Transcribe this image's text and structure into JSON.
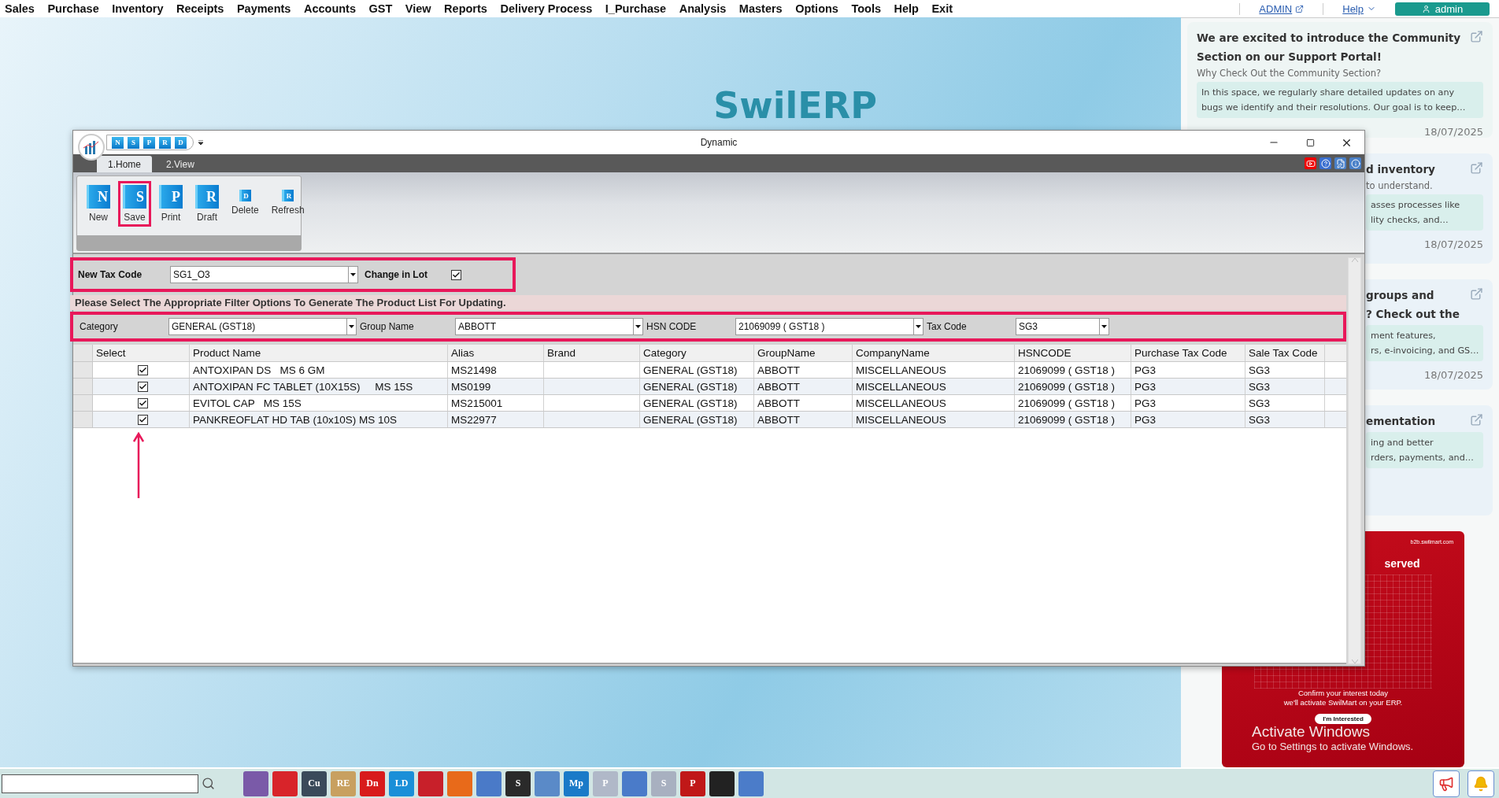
{
  "menu": {
    "items": [
      "Sales",
      "Purchase",
      "Inventory",
      "Receipts",
      "Payments",
      "Accounts",
      "GST",
      "View",
      "Reports",
      "Delivery Process",
      "I_Purchase",
      "Analysis",
      "Masters",
      "Options",
      "Tools",
      "Help",
      "Exit"
    ],
    "admin_link": "ADMIN",
    "help": "Help",
    "user": "admin"
  },
  "desktop": {
    "logo": "SwilERP"
  },
  "dialog": {
    "title": "Dynamic",
    "quick_access": [
      "N",
      "S",
      "P",
      "R",
      "D"
    ],
    "tabs": [
      {
        "label": "1.Home",
        "selected": true
      },
      {
        "label": "2.View",
        "selected": false
      }
    ],
    "ribbon_buttons": [
      {
        "label": "New",
        "glyph": "N",
        "kind": "large",
        "highlighted": false
      },
      {
        "label": "Save",
        "glyph": "S",
        "kind": "large",
        "highlighted": true
      },
      {
        "label": "Print",
        "glyph": "P",
        "kind": "large",
        "highlighted": false
      },
      {
        "label": "Draft",
        "glyph": "R",
        "kind": "large",
        "highlighted": false
      },
      {
        "label": "Delete",
        "glyph": "D",
        "kind": "small",
        "highlighted": false
      },
      {
        "label": "Refresh",
        "glyph": "R",
        "kind": "small",
        "highlighted": false
      }
    ],
    "tax_row": {
      "highlighted": true,
      "label": "New Tax Code",
      "value": "SG1_O3",
      "lot_label": "Change in Lot",
      "lot_checked": true
    },
    "notice": "Please Select The Appropriate Filter Options To Generate The Product List For Updating.",
    "filters": {
      "highlighted": true,
      "items": [
        {
          "label": "Category",
          "value": "GENERAL (GST18)"
        },
        {
          "label": "Group Name",
          "value": "ABBOTT"
        },
        {
          "label": "HSN CODE",
          "value": "21069099 ( GST18 )"
        },
        {
          "label": "Tax Code",
          "value": "SG3"
        }
      ]
    },
    "grid": {
      "select_label": "Select",
      "columns": [
        "Product Name",
        "Alias",
        "Brand",
        "Category",
        "GroupName",
        "CompanyName",
        "HSNCODE",
        "Purchase Tax Code",
        "Sale Tax Code"
      ],
      "rows": [
        {
          "checked": true,
          "cells": [
            "ANTOXIPAN DS   MS 6 GM",
            "MS21498",
            "",
            "GENERAL (GST18)",
            "ABBOTT",
            "MISCELLANEOUS",
            "21069099 ( GST18 )",
            "PG3",
            "SG3"
          ]
        },
        {
          "checked": true,
          "cells": [
            "ANTOXIPAN FC TABLET (10X15S)     MS 15S",
            "MS0199",
            "",
            "GENERAL (GST18)",
            "ABBOTT",
            "MISCELLANEOUS",
            "21069099 ( GST18 )",
            "PG3",
            "SG3"
          ]
        },
        {
          "checked": true,
          "cells": [
            "EVITOL CAP   MS 15S",
            "MS215001",
            "",
            "GENERAL (GST18)",
            "ABBOTT",
            "MISCELLANEOUS",
            "21069099 ( GST18 )",
            "PG3",
            "SG3"
          ]
        },
        {
          "checked": true,
          "cells": [
            "PANKREOFLAT HD TAB (10x10S) MS 10S",
            "MS22977",
            "",
            "GENERAL (GST18)",
            "ABBOTT",
            "MISCELLANEOUS",
            "21069099 ( GST18 )",
            "PG3",
            "SG3"
          ]
        }
      ]
    },
    "arrow_visible": true
  },
  "side_panel": {
    "cards": [
      {
        "title_lines": [
          "We are excited to introduce the Community",
          "Section on our Support Portal!"
        ],
        "subtitle": "Why Check Out the Community Section?",
        "desc_lines": [
          "In this space, we regularly share detailed updates on any",
          "bugs we identify and their resolutions. Our goal is to keep…"
        ],
        "date": "18/07/2025",
        "partial": false
      },
      {
        "title_lines": [
          "d inventory"
        ],
        "subtitle": "to understand.",
        "desc_lines": [
          "asses processes like",
          "lity checks, and…"
        ],
        "date": "18/07/2025",
        "partial": true
      },
      {
        "title_lines": [
          "groups and",
          "? Check out the"
        ],
        "desc_lines": [
          "ment features,",
          "rs, e-invoicing, and GS…"
        ],
        "date": "18/07/2025",
        "partial": true
      },
      {
        "title_lines": [
          "ementation"
        ],
        "desc_lines": [
          "ing and better",
          "rders, payments, and…"
        ],
        "partial": true
      }
    ],
    "promo": {
      "site": "b2b.swilmart.com",
      "heading": "served",
      "lines": [
        "Confirm your interest today",
        "we'll activate SwilMart on your ERP."
      ],
      "button": "I'm Interested"
    }
  },
  "activation": {
    "title": "Activate Windows",
    "hint": "Go to Settings to activate Windows."
  },
  "taskbar": {
    "apps": [
      {
        "color": "#7a5aa8"
      },
      {
        "color": "#d8242a"
      },
      {
        "color": "#3a4a5a",
        "label": "Cu"
      },
      {
        "color": "#c8a060",
        "label": "RE"
      },
      {
        "color": "#d81b1b",
        "label": "Dn"
      },
      {
        "color": "#1a8fd8",
        "label": "LD"
      },
      {
        "color": "#c8202a"
      },
      {
        "color": "#e86a1a"
      },
      {
        "color": "#4a7ac8"
      },
      {
        "color": "#2a2a2a",
        "label": "S"
      },
      {
        "color": "#5a8ac8"
      },
      {
        "color": "#1a7ac8",
        "label": "Mp"
      },
      {
        "color": "#b0b8c8",
        "label": "P"
      },
      {
        "color": "#4a7bc9"
      },
      {
        "color": "#a8b0c0",
        "label": "S"
      },
      {
        "color": "#c01818",
        "label": "P"
      },
      {
        "color": "#222222"
      },
      {
        "color": "#4b7cc9"
      }
    ]
  }
}
